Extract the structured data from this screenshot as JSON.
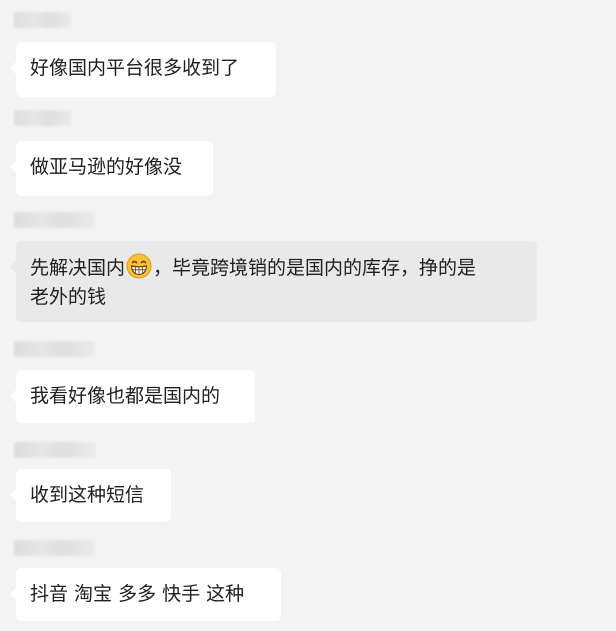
{
  "messages": [
    {
      "text": "好像国内平台很多收到了"
    },
    {
      "text": "做亚马逊的好像没"
    },
    {
      "text_before": "先解决国内",
      "emoji": "grinning-face-emoji",
      "text_after": "，毕竟跨境销的是国内的库存，挣的是",
      "text_line2": "老外的钱"
    },
    {
      "text": "我看好像也都是国内的"
    },
    {
      "text": "收到这种短信"
    },
    {
      "text": "抖音 淘宝 多多 快手 这种"
    }
  ],
  "colors": {
    "background": "#f3f3f3",
    "bubble": "#ffffff",
    "bubble_highlight": "#e9e9e9",
    "text": "#202020",
    "emoji_face": "#f7c23a"
  }
}
